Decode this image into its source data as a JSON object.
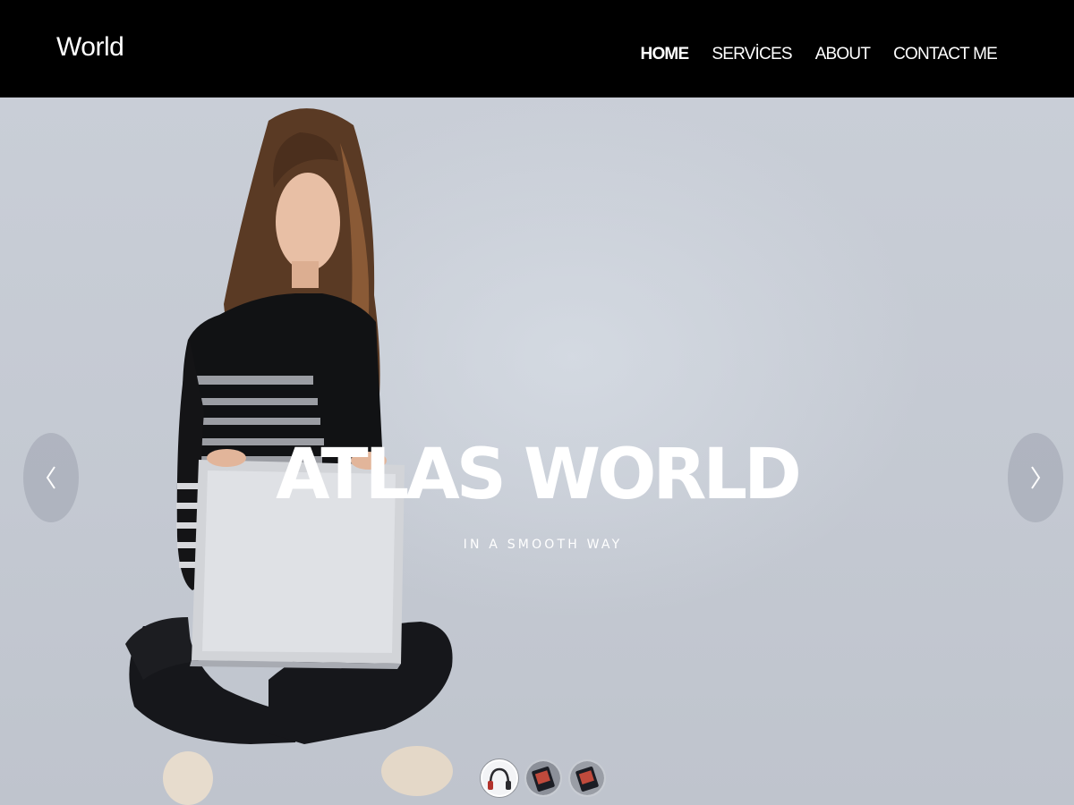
{
  "brand": {
    "name": "World"
  },
  "nav": {
    "items": [
      {
        "label": "HOME",
        "active": true
      },
      {
        "label": "SERVİCES",
        "active": false
      },
      {
        "label": "ABOUT",
        "active": false
      },
      {
        "label": "CONTACT ME",
        "active": false
      }
    ]
  },
  "hero": {
    "title": "ATLAS WORLD",
    "subtitle": "IN A SMOOTH WAY",
    "prev_icon": "chevron-left-icon",
    "next_icon": "chevron-right-icon",
    "thumbnails": [
      {
        "icon": "headphones-thumbnail",
        "active": true
      },
      {
        "icon": "tablet-thumbnail",
        "active": false
      },
      {
        "icon": "tablet-thumbnail",
        "active": false
      }
    ]
  },
  "colors": {
    "nav_background": "#000000",
    "hero_background": "#c7ccd5",
    "text": "#ffffff"
  }
}
